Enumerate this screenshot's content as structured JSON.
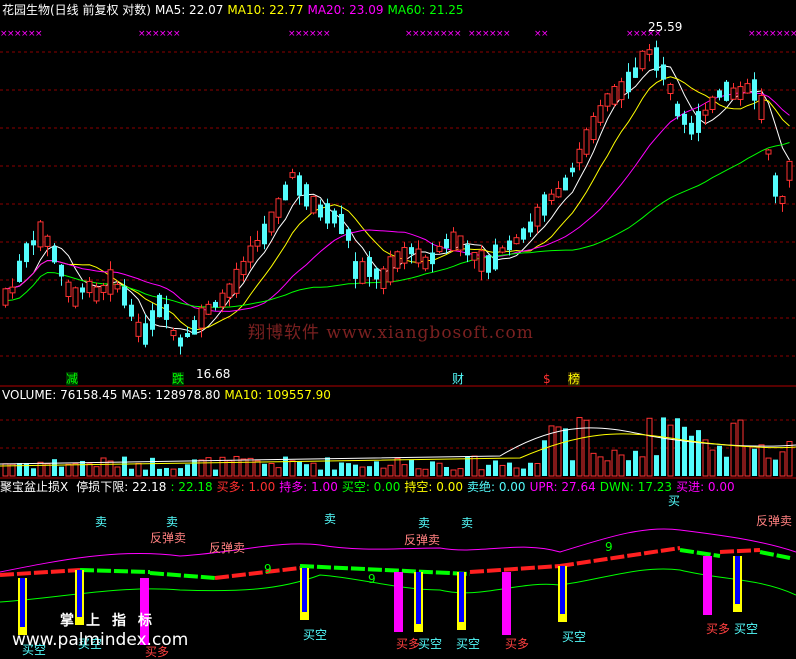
{
  "main_header": {
    "title": "花园生物(日线 前复权 对数)",
    "ma5": "MA5: 22.07",
    "ma10": "MA10: 22.77",
    "ma20": "MA20: 23.09",
    "ma60": "MA60: 21.25"
  },
  "price_labels": {
    "high": "25.59",
    "low": "16.68"
  },
  "event_markers": {
    "jian": "减",
    "die": "跌",
    "cai": "财",
    "dollar": "$",
    "bang": "榜"
  },
  "volume_header": {
    "volume": "VOLUME: 76158.45",
    "ma5": "MA5: 128978.80",
    "ma10": "MA10: 109557.90"
  },
  "indicator_header": {
    "name": "聚宝盆止损X",
    "stop_label": "停损下限: 22.18",
    "stop_value": ": 22.18",
    "buy_more": "买多: 1.00",
    "hold_more": "持多: 1.00",
    "buy_short": "买空: 0.00",
    "hold_short": "持空: 0.00",
    "sell_out": "卖绝: 0.00",
    "upr": "UPR: 27.64",
    "dwn": "DWN: 17.23",
    "buy_in": "买进: 0.00"
  },
  "indicator_labels": {
    "sell": "卖",
    "rebound_sell": "反弹卖",
    "buy_short": "买空",
    "buy_more": "买多",
    "nine": "9"
  },
  "watermarks": {
    "site": "翔博软件 www.xiangbosoft.com",
    "palm_title": "掌上指标",
    "palm_url": "www.palmindex.com"
  },
  "colors": {
    "up": "#ff3232",
    "down": "#54fcfc",
    "ma5": "#ffffff",
    "ma10": "#ffff00",
    "ma20": "#ff00ff",
    "ma60": "#00ff00",
    "grid": "#8b0000",
    "buy_more_tag": "#ff3030",
    "buy_short_tag": "#ffff00"
  }
}
